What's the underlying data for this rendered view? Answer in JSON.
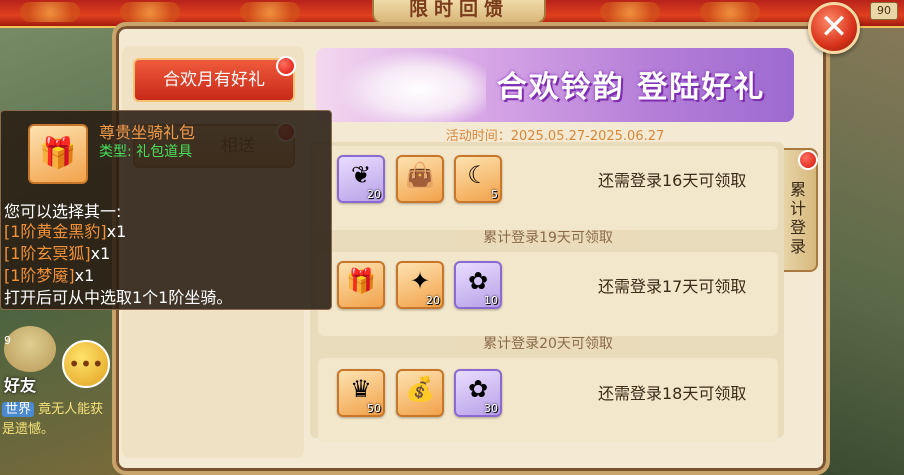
{
  "header": {
    "title": "限时回馈",
    "level_badge": "90",
    "close_symbol": "✕"
  },
  "sidebar": {
    "tabs": [
      {
        "label": "合欢月有好礼",
        "active": true
      },
      {
        "label": "相送",
        "active": false
      }
    ]
  },
  "banner": {
    "title": "合欢铃韵 登陆好礼",
    "event_time": "活动时间：2025.05.27-2025.06.27"
  },
  "side_tab": {
    "label": "累计登录"
  },
  "rewards": [
    {
      "requirement": "还需登录16天可领取",
      "items": [
        {
          "icon": "feather-icon",
          "count": "20"
        },
        {
          "icon": "gift-bag-icon",
          "count": ""
        },
        {
          "icon": "moon-gem-icon",
          "count": "5"
        }
      ]
    },
    {
      "header": "累计登录19天可领取",
      "requirement": "还需登录17天可领取",
      "items": [
        {
          "icon": "gift-box-icon",
          "count": ""
        },
        {
          "icon": "sparkle-icon",
          "count": "20"
        },
        {
          "icon": "flower-wand-icon",
          "count": "10"
        }
      ]
    },
    {
      "header": "累计登录20天可领取",
      "requirement": "还需登录18天可领取",
      "items": [
        {
          "icon": "crystal-icon",
          "count": "50"
        },
        {
          "icon": "money-bag-icon",
          "count": ""
        },
        {
          "icon": "flower-wand-icon",
          "count": "30"
        }
      ]
    }
  ],
  "tooltip": {
    "title": "尊贵坐骑礼包",
    "type": "类型: 礼包道具",
    "intro": "您可以选择其一:",
    "options": [
      {
        "name": "[1阶黄金黑豹]",
        "qty": "x1"
      },
      {
        "name": "[1阶玄冥狐]",
        "qty": "x1"
      },
      {
        "name": "[1阶梦魇]",
        "qty": "x1"
      }
    ],
    "footer": "打开后可从中选取1个1阶坐骑。"
  },
  "hud": {
    "friends_label": "好友",
    "world_tag": "世界",
    "world_msg": "竟无人能获",
    "world_msg2": "是遗憾。",
    "small_num": "9"
  },
  "colors": {
    "accent_red": "#d8321a",
    "panel_bg": "#f4ead4",
    "tooltip_title": "#f29a4a",
    "tooltip_type": "#4adf5a"
  }
}
